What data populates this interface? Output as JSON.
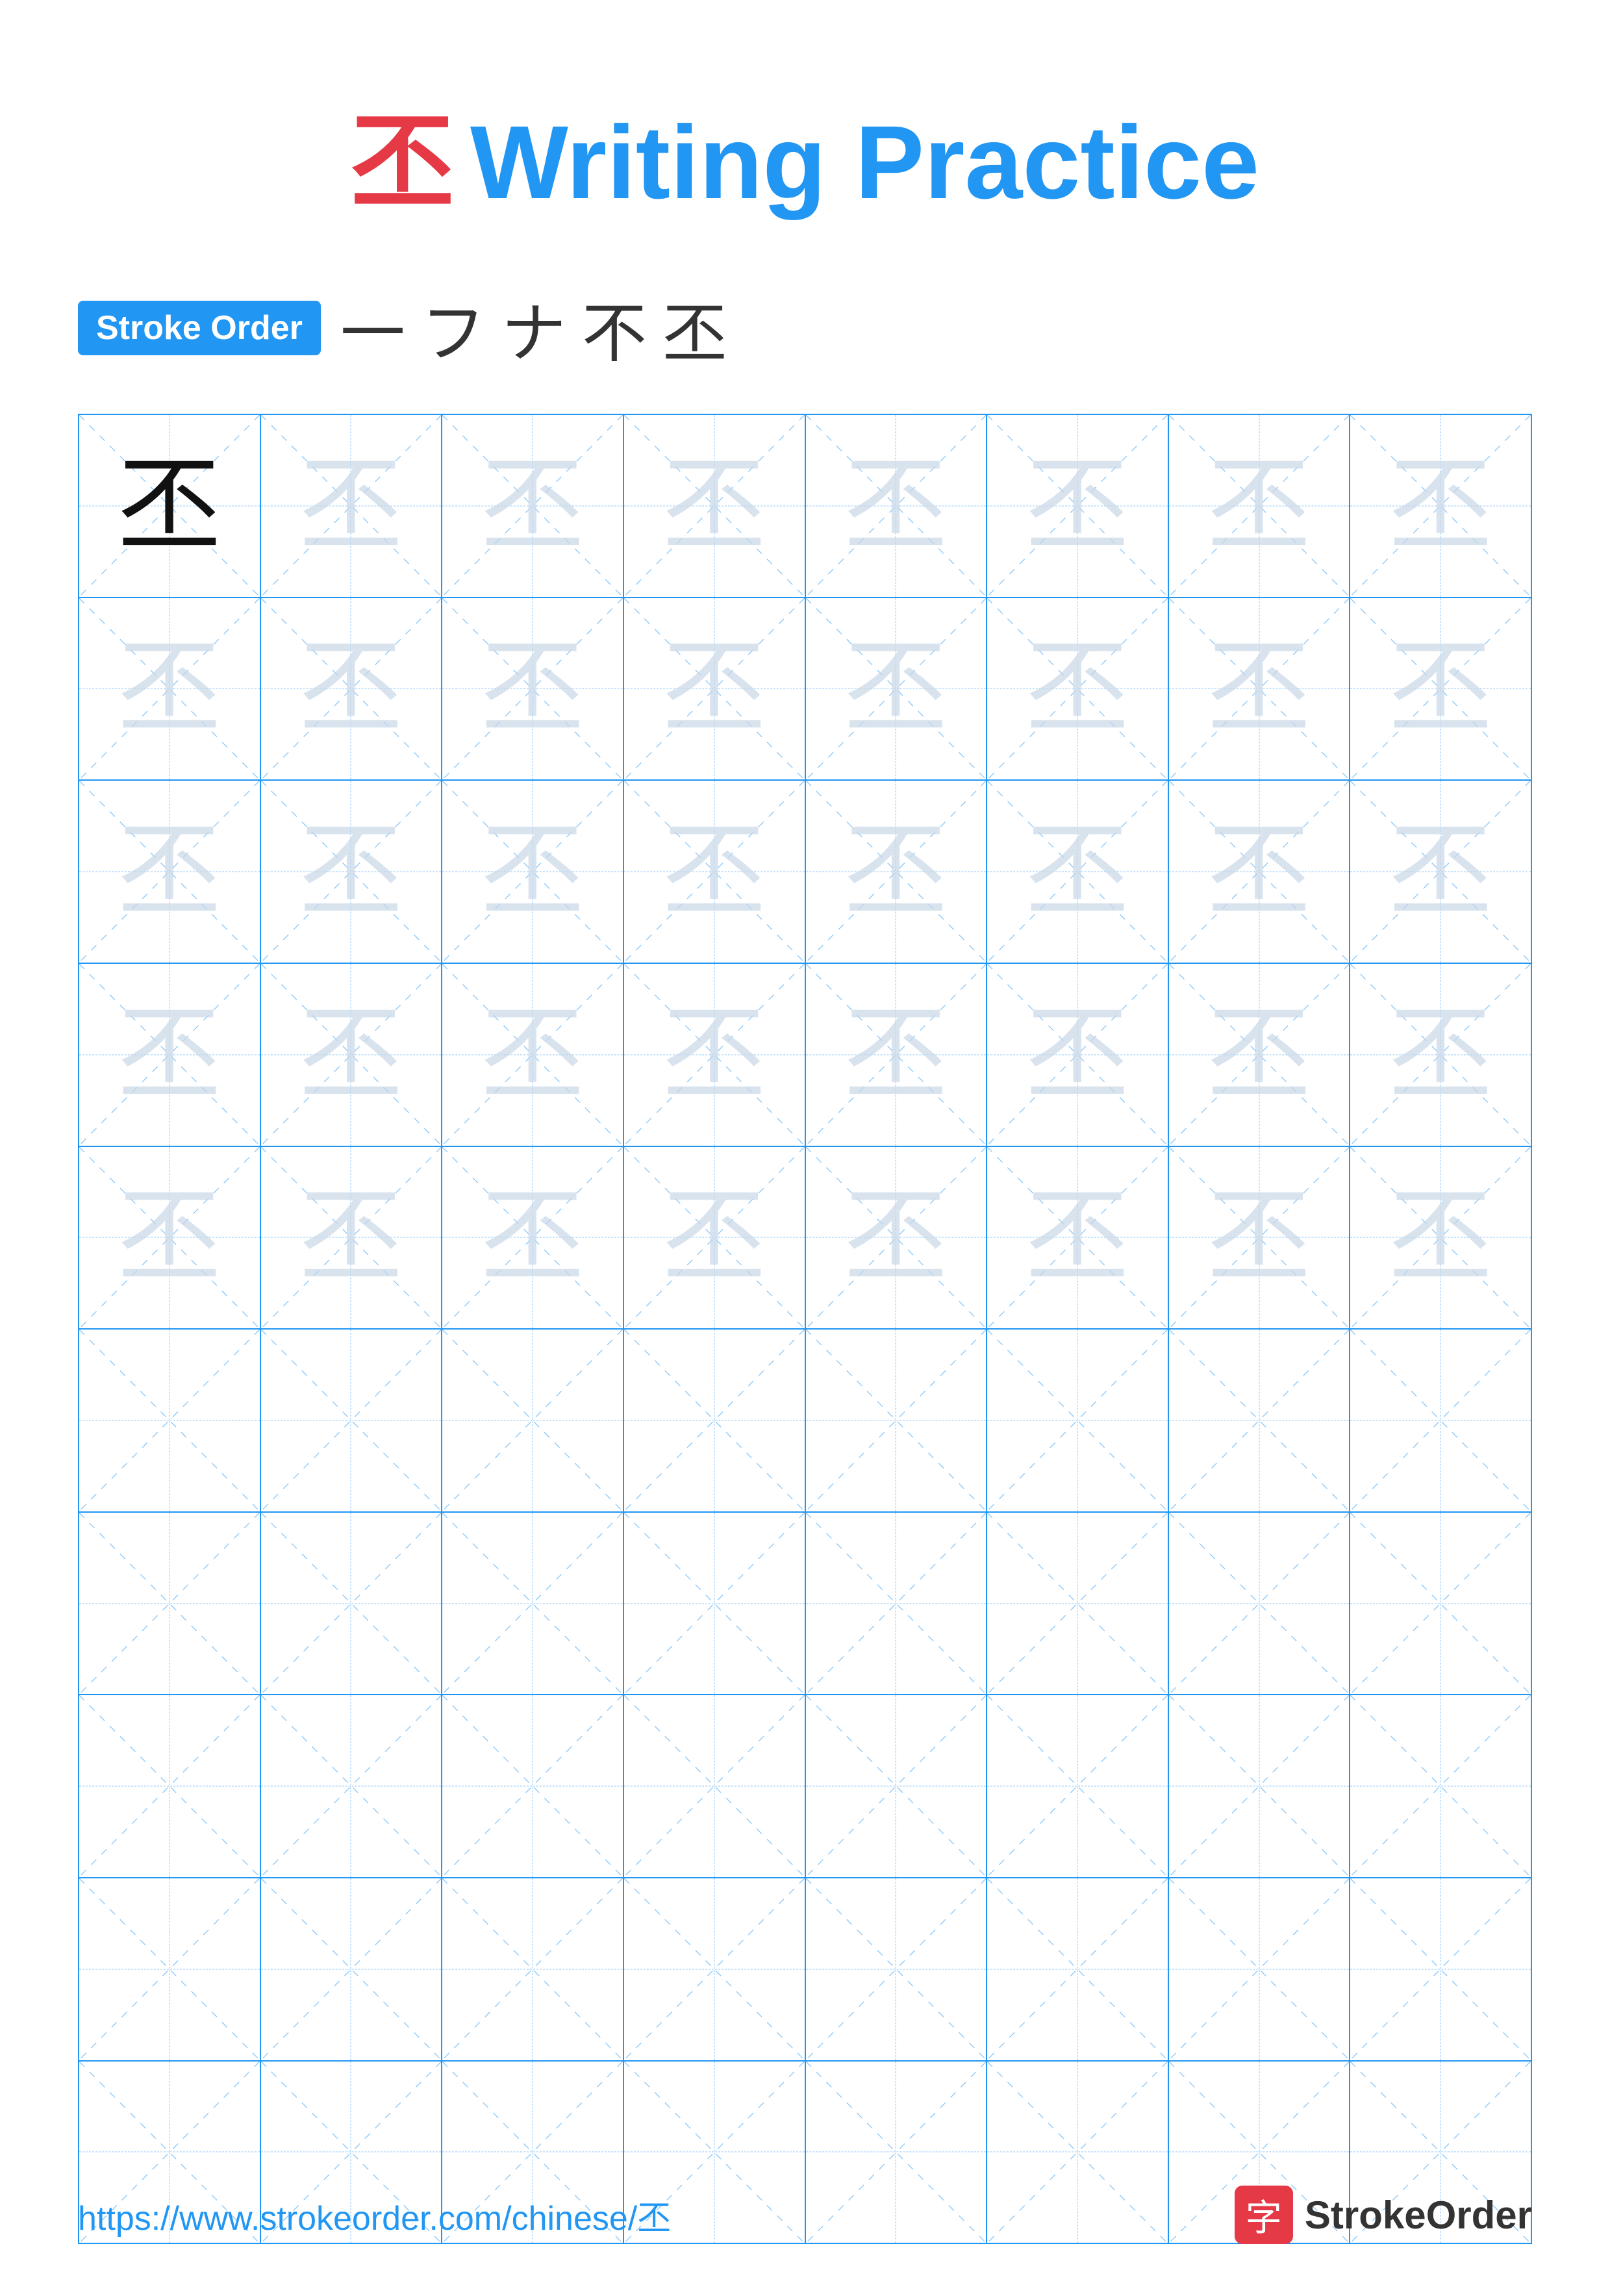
{
  "title": {
    "char": "丕",
    "writing_practice": "Writing Practice"
  },
  "stroke_order": {
    "badge_label": "Stroke Order",
    "strokes": [
      "一",
      "フ",
      "ナ",
      "不",
      "丕"
    ]
  },
  "grid": {
    "rows": 10,
    "cols": 8,
    "practice_char": "丕",
    "filled_rows": 5,
    "char_rows": [
      {
        "type": "dark_first",
        "chars": [
          "dark",
          "light",
          "light",
          "light",
          "light",
          "light",
          "light",
          "light"
        ]
      },
      {
        "type": "light",
        "chars": [
          "light",
          "light",
          "light",
          "light",
          "light",
          "light",
          "light",
          "light"
        ]
      },
      {
        "type": "light",
        "chars": [
          "light",
          "light",
          "light",
          "light",
          "light",
          "light",
          "light",
          "light"
        ]
      },
      {
        "type": "light",
        "chars": [
          "light",
          "light",
          "light",
          "light",
          "light",
          "light",
          "light",
          "light"
        ]
      },
      {
        "type": "light",
        "chars": [
          "light",
          "light",
          "light",
          "light",
          "light",
          "light",
          "light",
          "light"
        ]
      },
      {
        "type": "empty"
      },
      {
        "type": "empty"
      },
      {
        "type": "empty"
      },
      {
        "type": "empty"
      },
      {
        "type": "empty"
      }
    ]
  },
  "footer": {
    "url": "https://www.strokeorder.com/chinese/丕",
    "logo_char": "字",
    "logo_text": "StrokeOrder"
  }
}
